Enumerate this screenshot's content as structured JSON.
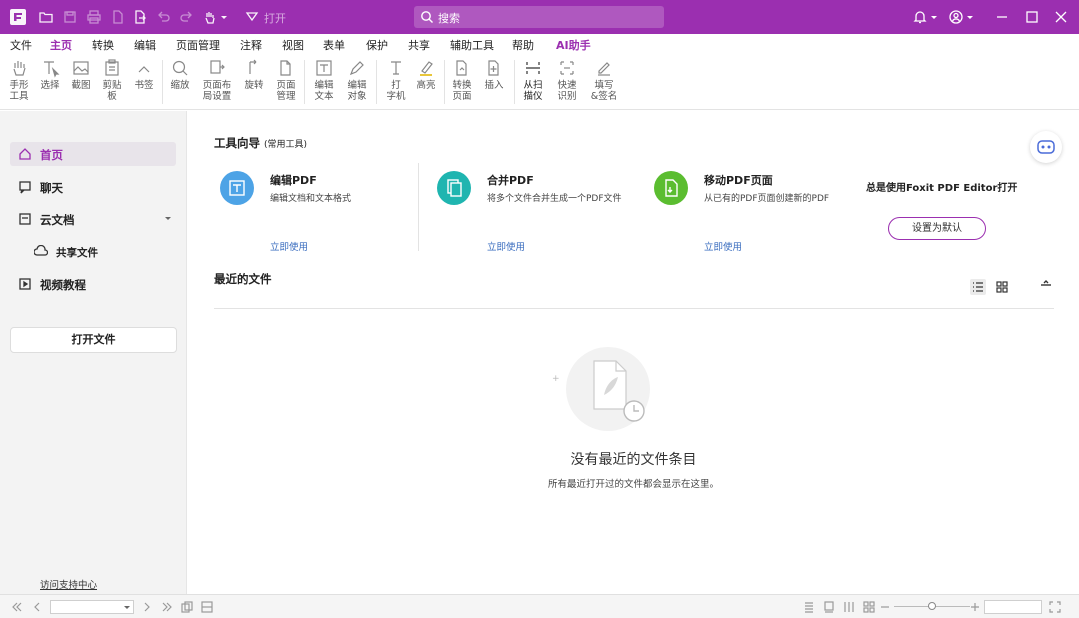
{
  "titlebar": {
    "open_label": "打开",
    "search_placeholder": "搜索",
    "accent_color": "#9b2fb0"
  },
  "menu": {
    "tabs": [
      "文件",
      "主页",
      "转换",
      "编辑",
      "页面管理",
      "注释",
      "视图",
      "表单",
      "保护",
      "共享",
      "辅助工具",
      "帮助",
      "AI助手"
    ],
    "active": "主页"
  },
  "ribbon": {
    "items": [
      {
        "label": "手形\n工具",
        "icon": "hand-icon"
      },
      {
        "label": "选择",
        "icon": "select-text-icon"
      },
      {
        "label": "截图",
        "icon": "snapshot-icon"
      },
      {
        "label": "剪贴\n板",
        "icon": "clipboard-icon"
      },
      {
        "label": "书签",
        "icon": "bookmark-icon"
      },
      {
        "label": "缩放",
        "icon": "zoom-icon"
      },
      {
        "label": "页面布\n局设置",
        "icon": "page-layout-icon"
      },
      {
        "label": "旋转",
        "icon": "rotate-icon"
      },
      {
        "label": "页面\n管理",
        "icon": "page-manage-icon"
      },
      {
        "label": "编辑\n文本",
        "icon": "edit-text-icon"
      },
      {
        "label": "编辑\n对象",
        "icon": "edit-object-icon"
      },
      {
        "label": "打\n字机",
        "icon": "typewriter-icon"
      },
      {
        "label": "高亮",
        "icon": "highlight-icon"
      },
      {
        "label": "转换\n页面",
        "icon": "convert-page-icon"
      },
      {
        "label": "插入",
        "icon": "insert-icon"
      },
      {
        "label": "从扫\n描仪",
        "icon": "scanner-icon"
      },
      {
        "label": "快速\n识别",
        "icon": "ocr-icon"
      },
      {
        "label": "填写\n&签名",
        "icon": "fill-sign-icon"
      }
    ]
  },
  "sidebar": {
    "items": [
      {
        "label": "首页",
        "icon": "home-icon"
      },
      {
        "label": "聊天",
        "icon": "chat-icon"
      },
      {
        "label": "云文档",
        "icon": "cloud-docs-icon"
      },
      {
        "label": "共享文件",
        "icon": "cloud-share-icon"
      },
      {
        "label": "视频教程",
        "icon": "video-tutorial-icon"
      }
    ],
    "open_file": "打开文件",
    "support": "访问支持中心"
  },
  "main": {
    "tool_guide": "工具向导",
    "tool_guide_sub": "(常用工具)",
    "cards": [
      {
        "title": "编辑PDF",
        "desc": "编辑文档和文本格式",
        "link": "立即使用",
        "color": "#4da3e6",
        "icon": "edit-pdf-icon"
      },
      {
        "title": "合并PDF",
        "desc": "将多个文件合并生成一个PDF文件",
        "link": "立即使用",
        "color": "#1fb5b0",
        "icon": "merge-pdf-icon"
      },
      {
        "title": "移动PDF页面",
        "desc": "从已有的PDF页面创建新的PDF",
        "link": "立即使用",
        "color": "#5bbd30",
        "icon": "move-pages-icon"
      }
    ],
    "promo": "总是使用Foxit PDF Editor打开",
    "set_default": "设置为默认",
    "recent": "最近的文件",
    "empty_title": "没有最近的文件条目",
    "empty_desc": "所有最近打开过的文件都会显示在这里。"
  }
}
